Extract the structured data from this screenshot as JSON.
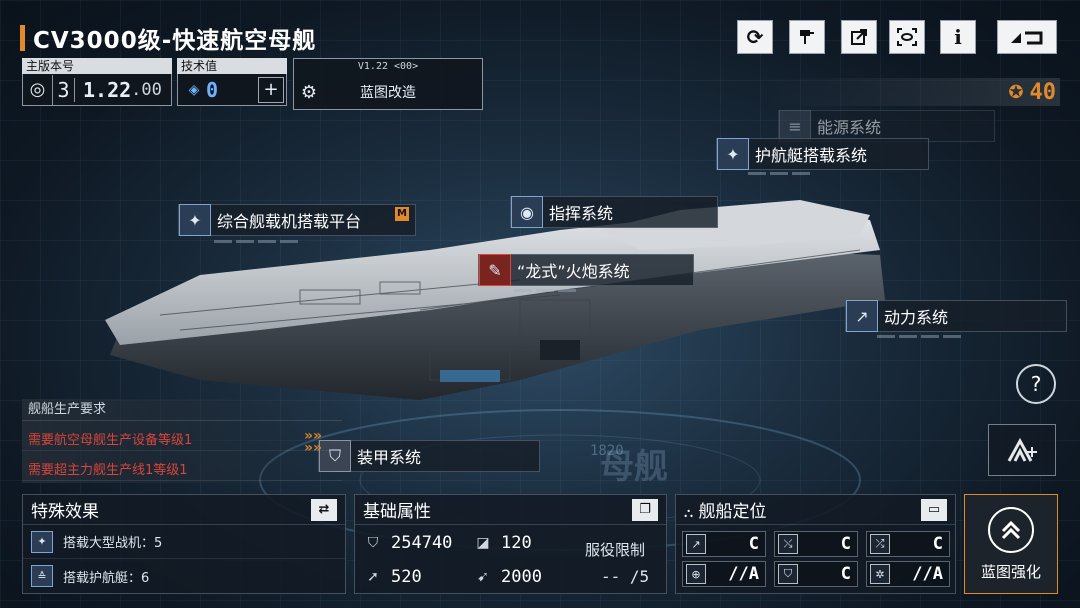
{
  "header": {
    "title": "CV3000级-快速航空母舰"
  },
  "top_buttons": {
    "refresh_icon": "refresh-icon",
    "paint_icon": "paint-icon",
    "share_icon": "share-icon",
    "scan_icon": "scan-icon",
    "info_label": "i",
    "back_icon": "back-icon"
  },
  "version": {
    "main_label": "主版本号",
    "main_digit": "3",
    "main_value": "1.22",
    "main_suffix": ".00",
    "tech_label": "技术值",
    "tech_value": "0",
    "mod_version": "V1.22 <00>",
    "mod_label": "蓝图改造"
  },
  "currency": {
    "value": "40"
  },
  "systems": {
    "energy": "能源系统",
    "escort": "护航艇搭载系统",
    "command": "指挥系统",
    "aircraft": "综合舰载机搭载平台",
    "aircraft_badge": "M",
    "cannon": "“龙式”火炮系统",
    "power": "动力系统",
    "armor": "装甲系统"
  },
  "production": {
    "title": "舰船生产要求",
    "req1": "需要航空母舰生产设备等级1",
    "req2": "需要超主力舰生产线1等级1"
  },
  "special": {
    "title": "特殊效果",
    "row1": "搭载大型战机：5",
    "row2": "搭载护航艇：6"
  },
  "attributes": {
    "title": "基础属性",
    "hp": "254740",
    "armor": "120",
    "speed": "520",
    "warp": "2000",
    "service_label": "服役限制",
    "service_value": "-- /5"
  },
  "positioning": {
    "title": "舰船定位",
    "grades": [
      "C",
      "C",
      "C",
      "//A",
      "C",
      "//A"
    ]
  },
  "upgrade": {
    "label": "蓝图强化"
  },
  "watermark": {
    "num": "1820",
    "text": "母舰"
  },
  "colors": {
    "accent_orange": "#e08a2c",
    "red_text": "#d8453a",
    "icon_blue": "#2b3d55"
  }
}
